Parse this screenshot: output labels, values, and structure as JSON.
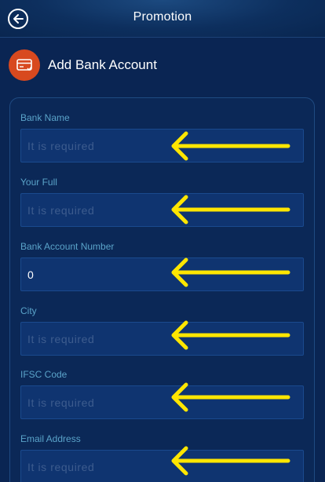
{
  "header": {
    "title": "Promotion"
  },
  "section": {
    "title": "Add Bank Account"
  },
  "fields": [
    {
      "label": "Bank Name",
      "value": "",
      "placeholder": "It is required"
    },
    {
      "label": "Your Full",
      "value": "",
      "placeholder": "It is required"
    },
    {
      "label": "Bank Account Number",
      "value": "0",
      "placeholder": ""
    },
    {
      "label": "City",
      "value": "",
      "placeholder": "It is required"
    },
    {
      "label": "IFSC Code",
      "value": "",
      "placeholder": "It is required"
    },
    {
      "label": "Email Address",
      "value": "",
      "placeholder": "It is required"
    }
  ],
  "colors": {
    "background": "#0a2553",
    "input_bg": "#0f3470",
    "label": "#5aa3c9",
    "icon_accent": "#d8491f",
    "annotation_arrow": "#ffe600"
  }
}
